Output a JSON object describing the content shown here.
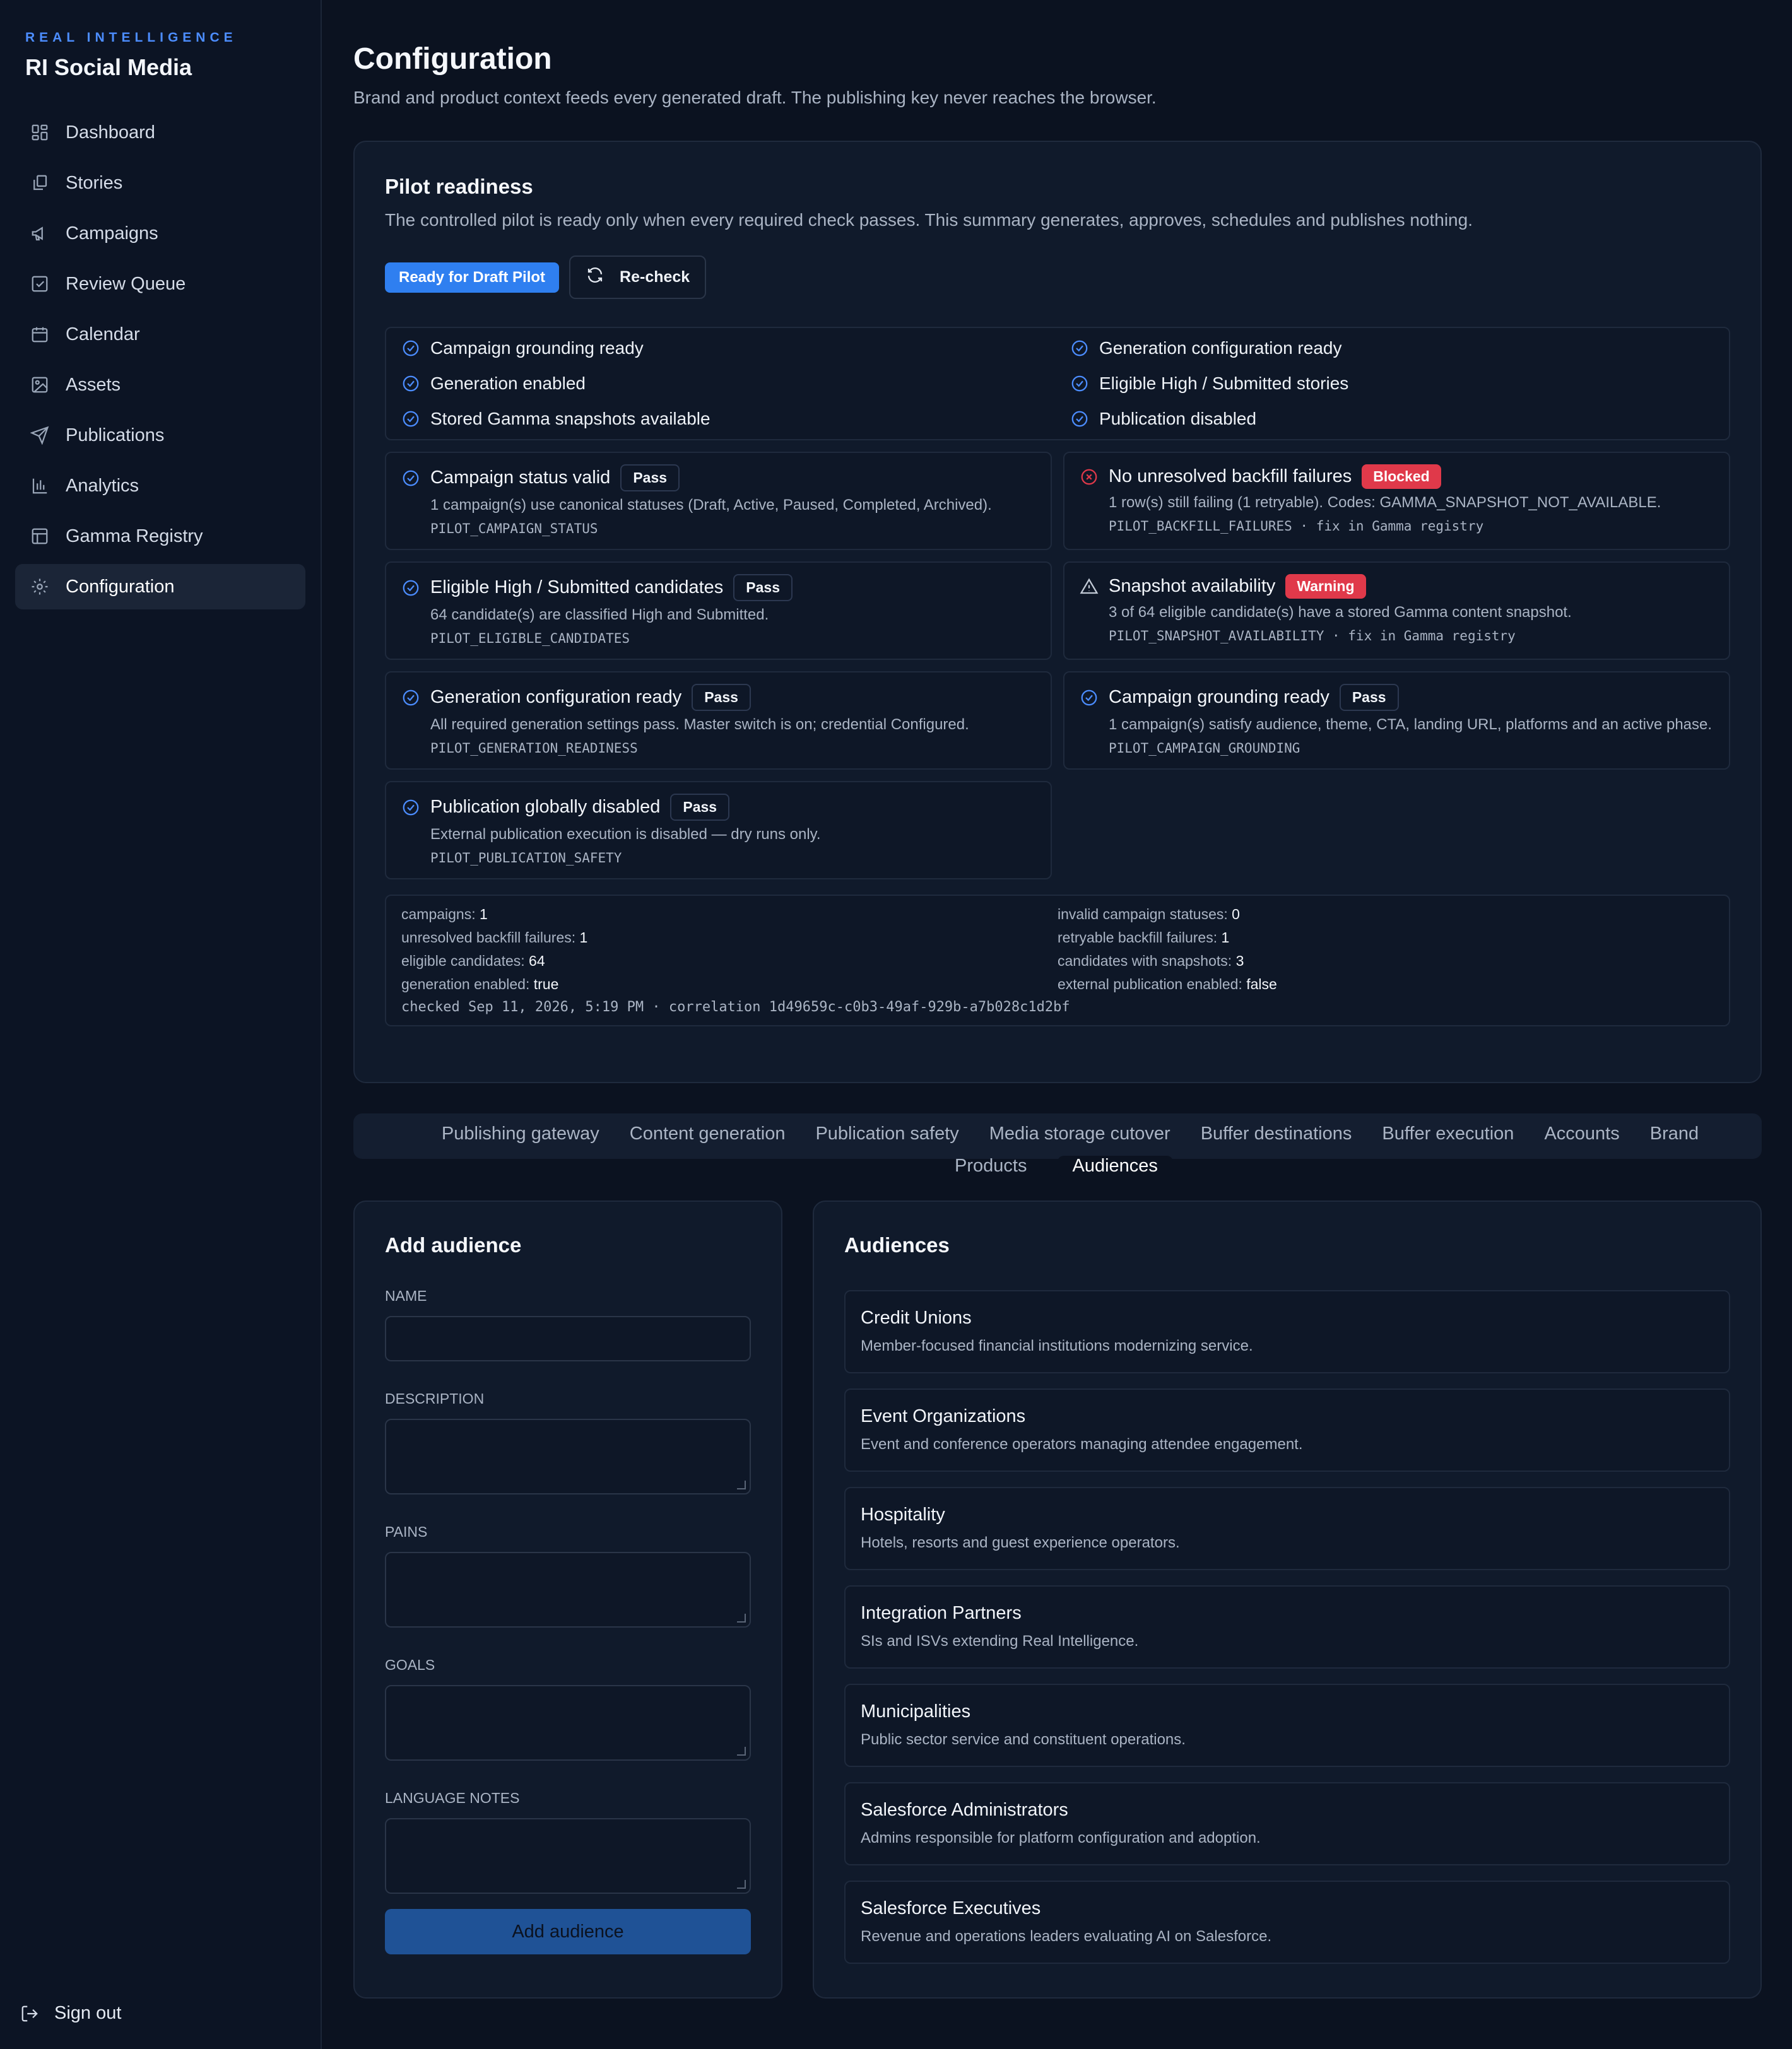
{
  "sidebar": {
    "kicker": "REAL INTELLIGENCE",
    "brand": "RI Social Media",
    "items": [
      {
        "label": "Dashboard",
        "icon": "dashboard-icon"
      },
      {
        "label": "Stories",
        "icon": "stories-icon"
      },
      {
        "label": "Campaigns",
        "icon": "megaphone-icon"
      },
      {
        "label": "Review Queue",
        "icon": "checkbox-icon"
      },
      {
        "label": "Calendar",
        "icon": "calendar-icon"
      },
      {
        "label": "Assets",
        "icon": "image-icon"
      },
      {
        "label": "Publications",
        "icon": "send-icon"
      },
      {
        "label": "Analytics",
        "icon": "bar-chart-icon"
      },
      {
        "label": "Gamma Registry",
        "icon": "table-icon"
      },
      {
        "label": "Configuration",
        "icon": "gear-icon",
        "active": true
      }
    ],
    "signout": "Sign out"
  },
  "page": {
    "title": "Configuration",
    "subtitle": "Brand and product context feeds every generated draft. The publishing key never reaches the browser."
  },
  "readiness": {
    "title": "Pilot readiness",
    "subtitle": "The controlled pilot is ready only when every required check passes. This summary generates, approves, schedules and publishes nothing.",
    "status_pill": "Ready for Draft Pilot",
    "recheck": "Re-check",
    "checklist": [
      "Campaign grounding ready",
      "Generation configuration ready",
      "Generation enabled",
      "Eligible High / Submitted stories",
      "Stored Gamma snapshots available",
      "Publication disabled"
    ],
    "details": [
      {
        "title": "Campaign status valid",
        "badge": "Pass",
        "desc": "1 campaign(s) use canonical statuses (Draft, Active, Paused, Completed, Archived).",
        "code": "PILOT_CAMPAIGN_STATUS"
      },
      {
        "title": "No unresolved backfill failures",
        "badge": "Blocked",
        "desc": "1 row(s) still failing (1 retryable). Codes: GAMMA_SNAPSHOT_NOT_AVAILABLE.",
        "code": "PILOT_BACKFILL_FAILURES · fix in Gamma registry"
      },
      {
        "title": "Eligible High / Submitted candidates",
        "badge": "Pass",
        "desc": "64 candidate(s) are classified High and Submitted.",
        "code": "PILOT_ELIGIBLE_CANDIDATES"
      },
      {
        "title": "Snapshot availability",
        "badge": "Warning",
        "desc": "3 of 64 eligible candidate(s) have a stored Gamma content snapshot.",
        "code": "PILOT_SNAPSHOT_AVAILABILITY · fix in Gamma registry"
      },
      {
        "title": "Generation configuration ready",
        "badge": "Pass",
        "desc": "All required generation settings pass. Master switch is on; credential Configured.",
        "code": "PILOT_GENERATION_READINESS"
      },
      {
        "title": "Campaign grounding ready",
        "badge": "Pass",
        "desc": "1 campaign(s) satisfy audience, theme, CTA, landing URL, platforms and an active phase.",
        "code": "PILOT_CAMPAIGN_GROUNDING"
      },
      {
        "title": "Publication globally disabled",
        "badge": "Pass",
        "desc": "External publication execution is disabled — dry runs only.",
        "code": "PILOT_PUBLICATION_SAFETY"
      }
    ],
    "metrics": [
      {
        "label": "campaigns:",
        "value": "1"
      },
      {
        "label": "invalid campaign statuses:",
        "value": "0"
      },
      {
        "label": "unresolved backfill failures:",
        "value": "1"
      },
      {
        "label": "retryable backfill failures:",
        "value": "1"
      },
      {
        "label": "eligible candidates:",
        "value": "64"
      },
      {
        "label": "candidates with snapshots:",
        "value": "3"
      },
      {
        "label": "generation enabled:",
        "value": "true"
      },
      {
        "label": "external publication enabled:",
        "value": "false"
      }
    ],
    "footer": "checked Sep 11, 2026, 5:19 PM · correlation 1d49659c-c0b3-49af-929b-a7b028c1d2bf"
  },
  "tabs": {
    "row1": [
      "Publishing gateway",
      "Content generation",
      "Publication safety",
      "Media storage cutover",
      "Buffer destinations",
      "Buffer execution",
      "Accounts",
      "Brand"
    ],
    "row2": [
      "Products",
      "Audiences"
    ],
    "active": "Audiences"
  },
  "add_audience": {
    "title": "Add audience",
    "fields": {
      "name": {
        "label": "NAME",
        "value": "",
        "placeholder": ""
      },
      "description": {
        "label": "DESCRIPTION",
        "value": "",
        "placeholder": ""
      },
      "pains": {
        "label": "PAINS",
        "value": "",
        "placeholder": ""
      },
      "goals": {
        "label": "GOALS",
        "value": "",
        "placeholder": ""
      },
      "language_notes": {
        "label": "LANGUAGE NOTES",
        "value": "",
        "placeholder": ""
      }
    },
    "submit": "Add audience"
  },
  "audiences": {
    "title": "Audiences",
    "items": [
      {
        "name": "Credit Unions",
        "desc": "Member-focused financial institutions modernizing service."
      },
      {
        "name": "Event Organizations",
        "desc": "Event and conference operators managing attendee engagement."
      },
      {
        "name": "Hospitality",
        "desc": "Hotels, resorts and guest experience operators."
      },
      {
        "name": "Integration Partners",
        "desc": "SIs and ISVs extending Real Intelligence."
      },
      {
        "name": "Municipalities",
        "desc": "Public sector service and constituent operations."
      },
      {
        "name": "Salesforce Administrators",
        "desc": "Admins responsible for platform configuration and adoption."
      },
      {
        "name": "Salesforce Executives",
        "desc": "Revenue and operations leaders evaluating AI on Salesforce."
      }
    ]
  },
  "colors": {
    "accent": "#2f7ff0",
    "fail": "#e0394a",
    "bg": "#0b1220",
    "card": "#101a2b"
  }
}
